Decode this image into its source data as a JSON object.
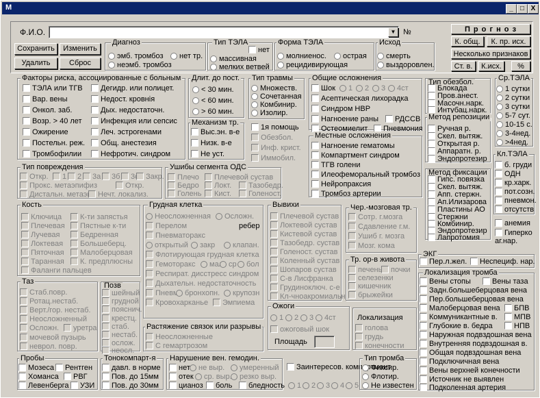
{
  "window": {
    "title": "M",
    "btn_min": "_",
    "btn_max": "□",
    "btn_close": "X"
  },
  "header": {
    "fio_label": "Ф.И.О.",
    "num_label": "№",
    "fio_value": ""
  },
  "buttons": {
    "save": "Сохранить",
    "change": "Изменить",
    "delete": "Удалить",
    "reset": "Сброс"
  },
  "right_buttons": {
    "forecast": "П р о г н о з",
    "k_gen": "К. общ.",
    "k_pr_ish": "К. пр. исх.",
    "several": "Несколько признаков",
    "st_v": "Ст. в.",
    "k_ish": "К.исх.",
    "percent": "%"
  },
  "diagnosis": {
    "title": "Диагноз",
    "opt1": "эмб. тромбоз",
    "opt2": "нет тр.",
    "opt3": "неэмб. тромбоз"
  },
  "tela_type": {
    "title": "Тип ТЭЛА",
    "net": "нет",
    "massive": "массивная",
    "small": "мелких ветвей"
  },
  "tela_form": {
    "title": "Форма ТЭЛА",
    "fulminant": "молниенос.",
    "acute": "острая",
    "recurrent": "рецидивирующая"
  },
  "outcome": {
    "title": "Исход",
    "death": "смерть",
    "recovery": "выздоровлен."
  },
  "risk": {
    "title": "Факторы риска, ассоциированные с больным",
    "items": [
      "ТЭЛА или ТГВ",
      "Вар. вены",
      "Онкол. заб.",
      "Возр. > 40 лет",
      "Ожирение",
      "Постельн. реж.",
      "Тромбофилии"
    ],
    "items2": [
      "Дегидр. или полицет.",
      "Недост. кровнія",
      "Дых. недостаточн.",
      "Инфекция или сепсис",
      "Леч. эстрогенами",
      "Общ. анестезия",
      "Нефротич. синдром"
    ]
  },
  "duration": {
    "title": "Длит. до пост.",
    "items": [
      "< 30 мин.",
      "< 60 мин.",
      "> 60 мин."
    ]
  },
  "mechanism": {
    "title": "Механизм тр.",
    "items": [
      "Выс.эн. в-е",
      "Низк. в-е",
      "Не уст."
    ]
  },
  "trauma_type": {
    "title": "Тип травмы",
    "items": [
      "Множеств.",
      "Сочетанная",
      "Комбинир.",
      "Изолир."
    ]
  },
  "first_aid": {
    "items": [
      "1я помощь",
      "Обезбол.",
      "Инф. крист.",
      "Иммобил."
    ]
  },
  "general_compl": {
    "title": "Общие осложнения",
    "shock": "Шок",
    "s1": "1",
    "s2": "2",
    "s3": "3",
    "s4": "4ст",
    "items": [
      "Асептическая лихорадка",
      "Синдром НВР",
      "Нагноение раны",
      "Остеомиелит"
    ],
    "rdss": "РДССВ",
    "pneumonia": "Пневмония"
  },
  "local_compl": {
    "title": "Местные осложнения",
    "items": [
      "Нагноение гематомы",
      "Компартмент синдром",
      "ТГВ голени",
      "Илеофеморальный тромбоз",
      "Нейропраксия",
      "Тромбоз артерии"
    ]
  },
  "anesthesia": {
    "title": "Тип обезбол.",
    "items": [
      "Блокада",
      "Пров.анест.",
      "Масочн.нарк.",
      "Интубац.нарк."
    ]
  },
  "sr_tela": {
    "title": "Ср.ТЭЛА",
    "items": [
      "1 сутки",
      "2 сутки",
      "3 сутки",
      "5-7 сут.",
      "10-15 с.",
      "3-4нед.",
      ">4нед."
    ]
  },
  "reposition": {
    "title": "Метод репозиции",
    "items": [
      "Ручная р.",
      "Скел. вытяж.",
      "Открытая р.",
      "Аппаратн. р.",
      "Эндопротезир"
    ]
  },
  "fixation": {
    "title": "Метод фиксации",
    "items": [
      "Гипс. повязка",
      "Скел. вытяж.",
      "Апп. стержн.",
      "Ап.Илизарова",
      "Пластины АО",
      "Стержни",
      "Комбинир.",
      "Эндопротезир",
      "Лапротомия"
    ]
  },
  "kl_tela": {
    "title": "Кл.ТЭЛА",
    "items": [
      "б. груди",
      "ОДН",
      "кр.харк.",
      "пот.созн.",
      "пневмон.",
      "отсутств"
    ]
  },
  "other_dx": {
    "items": [
      "анемия",
      "Гиперко аг.нар."
    ]
  },
  "injury_type": {
    "title": "Тип повреждения",
    "o1": "Откр.",
    "n1": "1",
    "n2": "2",
    "n3a": "3а",
    "n3b": "3б",
    "n3c": "3с",
    "zakr": "Закр.",
    "prox": "Прокс. метаэпифиз",
    "otkr2": "Откр.",
    "distal": "Дистальн. метаэп.",
    "necht": "Нечт. локализ."
  },
  "ods": {
    "title": "Ушибы сегмента ОДС",
    "items": [
      "Плечо",
      "Бедро",
      "Голень",
      "Плечевой сустав",
      "Локт.",
      "Кист.",
      "Тазобедр.",
      "Голеност."
    ]
  },
  "bone": {
    "title": "Кость",
    "items": [
      "Ключица",
      "Плечевая",
      "Лучевая",
      "Локтевая",
      "Пяточная",
      "Таранная",
      "Фаланги пальцев"
    ],
    "items2": [
      "К-ти запястья",
      "Пястные к-ти",
      "Бедренная",
      "Большеберц.",
      "Малоберцовая",
      "К. предплюсны"
    ]
  },
  "chest": {
    "title": "Грудная клетка",
    "items": [
      "Неосложненная",
      "Осложн.",
      "Перелом",
      "ребер",
      "Пневматоракс",
      "открытый",
      "закр",
      "клапан.",
      "Флотирующая грудная клетка",
      "Гемоторакс",
      "мал",
      "ср",
      "бол",
      "Респират. дисстресс синдром",
      "Дыхательн. недостаточность",
      "Пневм",
      "бронхопн.",
      "крупозн",
      "Кровохарканье",
      "Эмпиема"
    ]
  },
  "dislocations": {
    "title": "Вывихи",
    "items": [
      "Плечевой сустав",
      "Локтевой сустав",
      "Кистевой сустав",
      "Тазобедр. сустав",
      "Голеност. сустав",
      "Коленный сустав",
      "Шопаров сустав",
      "С-в Лисфранка",
      "Грудиноключ. с-е",
      "Кл-чноакромиальн."
    ]
  },
  "tbi": {
    "title": "Чер.-мозговая тр.",
    "items": [
      "Сотр. г.мозга",
      "Сдавление г.м.",
      "Ушиб г. мозга",
      "Мозг. кома"
    ]
  },
  "abdomen": {
    "title": "Тр. ор-в живота",
    "items": [
      "печень",
      "почки",
      "селезенки",
      "кишечник",
      "брыжейки"
    ]
  },
  "burns": {
    "title": "Ожоги",
    "b1": "1",
    "b2": "2",
    "b3": "3",
    "b4": "4ст",
    "shock": "ожоговый шок",
    "area_label": "Площадь",
    "area": ""
  },
  "localization": {
    "title": "Локализация",
    "items": [
      "голова",
      "грудь",
      "конечности"
    ]
  },
  "pelvis": {
    "title": "Таз",
    "items": [
      "Стаб.повр.",
      "Ротац.нестаб.",
      "Верт./гор. нестаб.",
      "Неосложненный",
      "Осложн.",
      "уретра",
      "мочевой пузырь",
      "неврол. повр."
    ]
  },
  "spine": {
    "title": "Позв",
    "items": [
      "шейный",
      "грудной",
      "пояснич.",
      "крестц.",
      "стаб.",
      "нестаб.",
      "ослож.",
      "неосл."
    ]
  },
  "ligaments": {
    "title": "Растяжение связок или разрывы",
    "items": [
      "Неосложненные",
      "С гемартрозом"
    ]
  },
  "probes": {
    "title": "Пробы",
    "items": [
      "Мозеса",
      "Рентген",
      "Хоманса",
      "РВГ",
      "Левенберга",
      "УЗИ"
    ]
  },
  "tonometry": {
    "title": "Тонокомпарт-я",
    "items": [
      "давл. в норме",
      "Пов. до 15мм",
      "Пов. до 30мм"
    ]
  },
  "venous": {
    "title": "Нарушение вен. гемодин.",
    "items": [
      "нет",
      "не выр.",
      "умеренный",
      "отек",
      "ср. выр.",
      "резко выр.",
      "цианоз",
      "боль",
      "бледность"
    ]
  },
  "interested": {
    "label": "Заинтересов. компартмент",
    "items": [
      "1",
      "2",
      "3",
      "4",
      "5"
    ]
  },
  "thrombus": {
    "title": "Тип тромба",
    "items": [
      "Фиксир.",
      "Флотир.",
      "Не известен"
    ]
  },
  "ekg": {
    "title": "ЭКГ",
    "items": [
      "Пер.л.жел.",
      "Неспециф. нар."
    ]
  },
  "thrombus_loc": {
    "title": "Локализация тромба",
    "items": [
      "Вены стопы",
      "Вены таза",
      "Задн.большеберцовая вена",
      "Пер.большеберцовая вена",
      "Малоберцовая вена",
      "БПВ",
      "Коммуникантные в.",
      "МПВ",
      "Глубокие в. бедра",
      "НПВ",
      "Наружная подвздошная вена",
      "Внутренняя подвздошная в.",
      "Общая подвздошная вена",
      "Подключичная вена",
      "Вены верхней конечности",
      "Источник не выявлен",
      "Подколенная артерия"
    ]
  }
}
